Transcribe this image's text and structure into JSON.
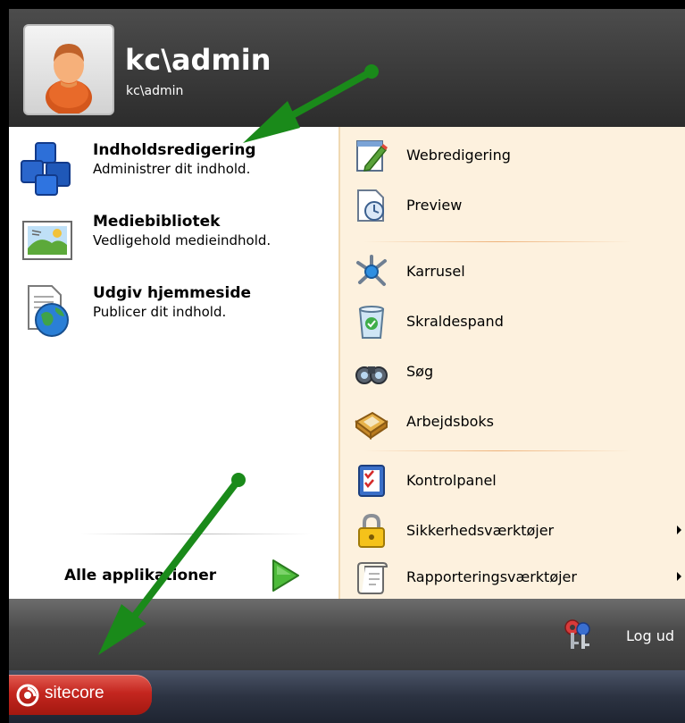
{
  "header": {
    "user_name": "kc\\admin",
    "user_sub": "kc\\admin"
  },
  "left_items": [
    {
      "title": "Indholdsredigering",
      "desc": "Administrer dit indhold.",
      "icon": "content-editor-icon"
    },
    {
      "title": "Mediebibliotek",
      "desc": "Vedligehold medieindhold.",
      "icon": "media-library-icon"
    },
    {
      "title": "Udgiv hjemmeside",
      "desc": "Publicer dit indhold.",
      "icon": "publish-globe-icon"
    }
  ],
  "all_apps": {
    "label": "Alle applikationer",
    "icon": "green-play-arrow-icon"
  },
  "right_items": [
    {
      "label": "Webredigering",
      "icon": "web-edit-icon"
    },
    {
      "label": "Preview",
      "icon": "preview-icon"
    },
    {
      "label": "Karrusel",
      "icon": "carousel-icon"
    },
    {
      "label": "Skraldespand",
      "icon": "recycle-bin-icon"
    },
    {
      "label": "Søg",
      "icon": "binoculars-icon"
    },
    {
      "label": "Arbejdsboks",
      "icon": "workbox-icon"
    },
    {
      "label": "Kontrolpanel",
      "icon": "control-panel-icon"
    },
    {
      "label": "Sikkerhedsværktøjer",
      "icon": "lock-icon",
      "submenu": true
    },
    {
      "label": "Rapporteringsværktøjer",
      "icon": "scroll-icon",
      "submenu": true
    }
  ],
  "footer": {
    "logout_label": "Log ud",
    "icon": "keys-icon"
  },
  "taskbar": {
    "start_label": "sitecore",
    "icon": "sitecore-logo-icon"
  },
  "colors": {
    "arrow_green": "#1a8a1a",
    "start_red": "#c4261f",
    "right_pane_bg": "#fdf1de"
  }
}
